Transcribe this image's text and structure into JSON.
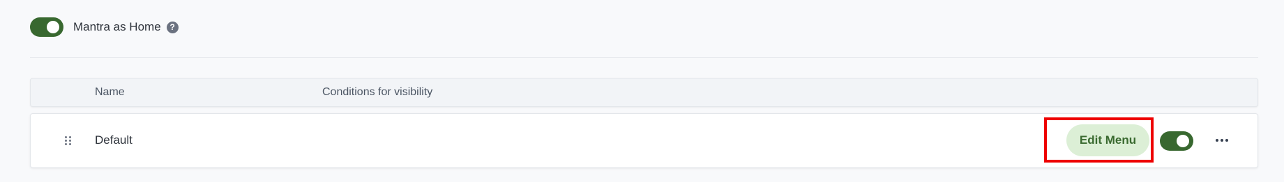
{
  "home_setting": {
    "label": "Mantra as Home",
    "enabled": true,
    "help_glyph": "?"
  },
  "table": {
    "columns": [
      "Name",
      "Conditions for visibility"
    ],
    "rows": [
      {
        "name": "Default",
        "conditions": "",
        "edit_label": "Edit Menu",
        "enabled": true
      }
    ]
  },
  "icons": {
    "help": "question-circle-icon",
    "drag": "drag-handle-icon",
    "more": "more-horizontal-icon"
  },
  "colors": {
    "toggle_on": "#38682f",
    "edit_button_bg": "#dcefd6",
    "edit_button_text": "#3a6a30",
    "highlight": "#ee0000"
  }
}
